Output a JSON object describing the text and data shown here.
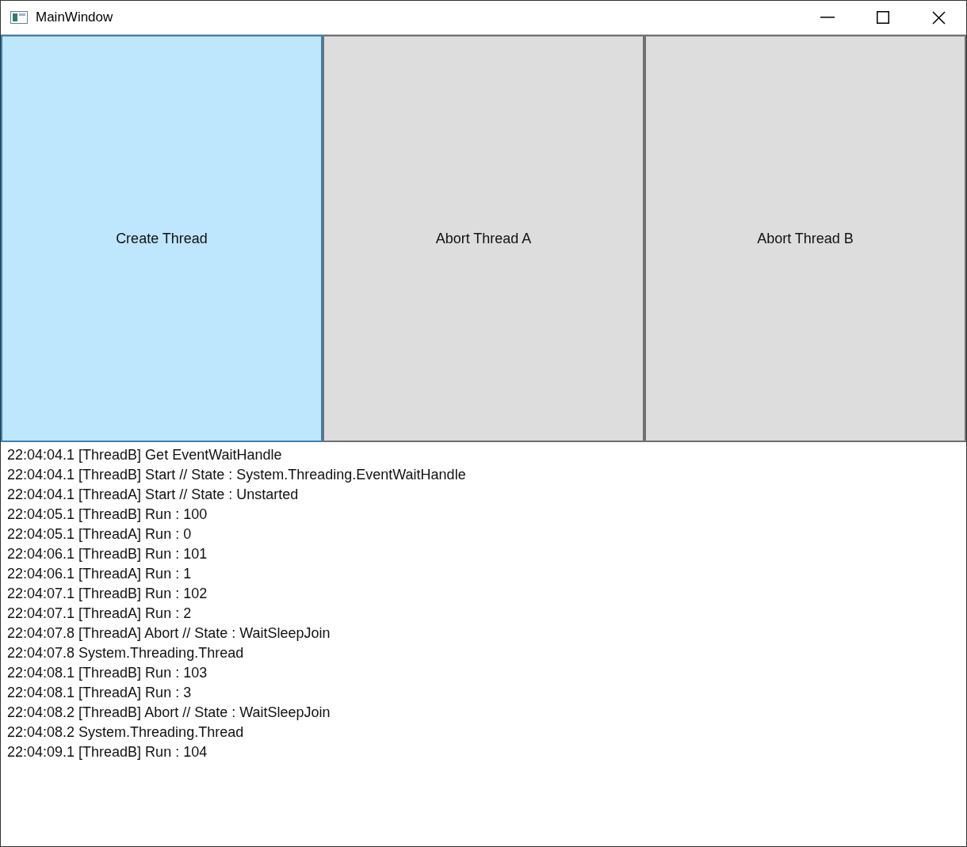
{
  "window": {
    "title": "MainWindow"
  },
  "buttons": [
    {
      "label": "Create Thread",
      "highlighted": true
    },
    {
      "label": "Abort Thread A",
      "highlighted": false
    },
    {
      "label": "Abort Thread B",
      "highlighted": false
    }
  ],
  "log": [
    "22:04:04.1 [ThreadB] Get EventWaitHandle",
    "22:04:04.1 [ThreadB] Start // State : System.Threading.EventWaitHandle",
    "22:04:04.1 [ThreadA] Start // State : Unstarted",
    "22:04:05.1 [ThreadB] Run : 100",
    "22:04:05.1 [ThreadA] Run : 0",
    "22:04:06.1 [ThreadB] Run : 101",
    "22:04:06.1 [ThreadA] Run : 1",
    "22:04:07.1 [ThreadB] Run : 102",
    "22:04:07.1 [ThreadA] Run : 2",
    "22:04:07.8 [ThreadA] Abort // State : WaitSleepJoin",
    "22:04:07.8 System.Threading.Thread",
    "22:04:08.1 [ThreadB] Run : 103",
    "22:04:08.1 [ThreadA] Run : 3",
    "22:04:08.2 [ThreadB] Abort // State : WaitSleepJoin",
    "22:04:08.2 System.Threading.Thread",
    "22:04:09.1 [ThreadB] Run : 104"
  ]
}
